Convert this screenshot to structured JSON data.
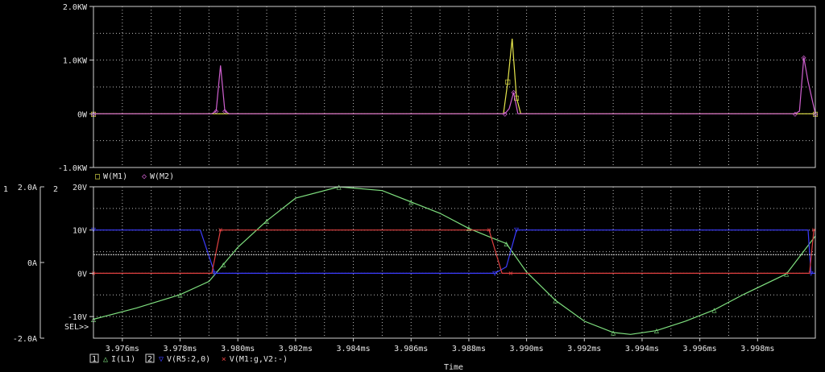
{
  "app": {
    "time_label": "Time",
    "sel_label": "SEL>>"
  },
  "colors": {
    "background": "#000000",
    "frame": "#d0d0d0",
    "grid": "#bdbdbd",
    "text": "#e6e6e6",
    "vm1": "#e6e64c",
    "vm2": "#d060d0",
    "il1": "#7fe07f",
    "vr5": "#3c3cff",
    "vm1gv2": "#e04040",
    "refline": "#e6e6e6"
  },
  "chart_data": [
    {
      "type": "line",
      "title": "",
      "xlabel": "Time",
      "ylabel": "",
      "xlim": [
        3.975,
        4.0
      ],
      "ylim": [
        -1.0,
        2.0
      ],
      "y_ticks": [
        {
          "value": 2.0,
          "label": "2.0KW"
        },
        {
          "value": 1.0,
          "label": "1.0KW"
        },
        {
          "value": 0.0,
          "label": "0W"
        },
        {
          "value": -1.0,
          "label": "-1.0KW"
        }
      ],
      "legend": [
        {
          "marker": "□",
          "label": "W(M1)",
          "color_key": "vm1"
        },
        {
          "marker": "◇",
          "label": "W(M2)",
          "color_key": "vm2"
        }
      ],
      "series": [
        {
          "name": "W(M1)",
          "color_key": "vm1",
          "x": [
            3.975,
            3.9892,
            3.98935,
            3.9895,
            3.98965,
            3.9898,
            4.0
          ],
          "y": [
            0,
            0,
            0.6,
            1.4,
            0.3,
            0,
            0
          ]
        },
        {
          "name": "W(M2)",
          "color_key": "vm2",
          "x": [
            3.975,
            3.9791,
            3.97925,
            3.9794,
            3.97955,
            3.9797,
            3.98925,
            3.9894,
            3.98955,
            3.9897,
            3.9993,
            3.99945,
            3.9996,
            3.99975,
            4.0
          ],
          "y": [
            0,
            0,
            0.05,
            0.9,
            0.05,
            0,
            0,
            0.1,
            0.4,
            0,
            0,
            0.05,
            1.05,
            0.6,
            0
          ]
        }
      ]
    },
    {
      "type": "line",
      "title": "",
      "xlabel": "Time",
      "xlim": [
        3.975,
        4.0
      ],
      "ylim": [
        -15,
        20
      ],
      "y_ticks": [
        {
          "value": 20,
          "label": "20V"
        },
        {
          "value": 10,
          "label": "10V"
        },
        {
          "value": 0,
          "label": "0V"
        },
        {
          "value": -10,
          "label": "-10V"
        }
      ],
      "left_axis": {
        "label": "1",
        "ticks": [
          {
            "value": 2.0,
            "label": "2.0A"
          },
          {
            "value": 0.0,
            "label": "0A"
          },
          {
            "value": -2.0,
            "label": "-2.0A"
          }
        ]
      },
      "right_axis_label": "2",
      "x_ticks": [
        {
          "value": 3.976,
          "label": "3.976ms"
        },
        {
          "value": 3.978,
          "label": "3.978ms"
        },
        {
          "value": 3.98,
          "label": "3.980ms"
        },
        {
          "value": 3.982,
          "label": "3.982ms"
        },
        {
          "value": 3.984,
          "label": "3.984ms"
        },
        {
          "value": 3.986,
          "label": "3.986ms"
        },
        {
          "value": 3.988,
          "label": "3.988ms"
        },
        {
          "value": 3.99,
          "label": "3.990ms"
        },
        {
          "value": 3.992,
          "label": "3.992ms"
        },
        {
          "value": 3.994,
          "label": "3.994ms"
        },
        {
          "value": 3.996,
          "label": "3.996ms"
        },
        {
          "value": 3.998,
          "label": "3.998ms"
        }
      ],
      "legend": [
        {
          "axis_box": "1",
          "marker": "△",
          "label": "I(L1)",
          "color_key": "il1"
        },
        {
          "axis_box": "2",
          "marker": "▽",
          "label": "V(R5:2,0)",
          "color_key": "vr5"
        },
        {
          "marker": "×",
          "label": "V(M1:g,V2:-)",
          "color_key": "vm1gv2"
        }
      ],
      "series": [
        {
          "name": "I(L1)",
          "axis": "left_A",
          "color_key": "il1",
          "x": [
            3.975,
            3.9765,
            3.978,
            3.979,
            3.9795,
            3.98,
            3.981,
            3.982,
            3.9835,
            3.985,
            3.986,
            3.987,
            3.988,
            3.9888,
            3.9893,
            3.99,
            3.991,
            3.992,
            3.993,
            3.9936,
            3.9945,
            3.9955,
            3.9965,
            3.9975,
            3.999,
            4.0
          ],
          "y": [
            -1.5,
            -1.2,
            -0.85,
            -0.5,
            -0.05,
            0.4,
            1.1,
            1.7,
            2.0,
            1.9,
            1.6,
            1.3,
            0.9,
            0.65,
            0.5,
            -0.25,
            -1.0,
            -1.55,
            -1.85,
            -1.9,
            -1.8,
            -1.55,
            -1.25,
            -0.85,
            -0.3,
            0.7
          ]
        },
        {
          "name": "V(R5:2,0)",
          "axis": "right_V",
          "color_key": "vr5",
          "x": [
            3.975,
            3.9787,
            3.9792,
            3.98,
            3.9889,
            3.9893,
            3.98965,
            3.99975,
            3.99985,
            4.0
          ],
          "y": [
            10,
            10,
            0,
            0,
            0,
            1.5,
            10,
            10,
            0,
            0
          ]
        },
        {
          "name": "V(M1:g,V2:-)",
          "axis": "right_V",
          "color_key": "vm1gv2",
          "x": [
            3.975,
            3.9791,
            3.9794,
            3.98,
            3.9887,
            3.98915,
            3.98945,
            3.9998,
            3.99995,
            4.0
          ],
          "y": [
            0,
            0,
            10,
            10,
            10,
            0,
            0,
            0,
            10,
            10
          ]
        },
        {
          "name": "reference",
          "axis": "right_V",
          "color_key": "refline",
          "x": [
            3.975,
            4.0
          ],
          "y": [
            4.3,
            4.3
          ]
        }
      ]
    }
  ]
}
